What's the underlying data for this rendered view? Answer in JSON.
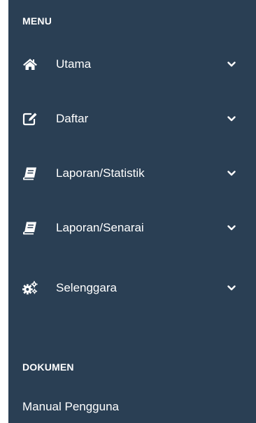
{
  "menu": {
    "title": "MENU",
    "items": [
      {
        "label": "Utama",
        "icon": "home-icon"
      },
      {
        "label": "Daftar",
        "icon": "edit-icon"
      },
      {
        "label": "Laporan/Statistik",
        "icon": "book-icon"
      },
      {
        "label": "Laporan/Senarai",
        "icon": "book-icon"
      },
      {
        "label": "Selenggara",
        "icon": "cogs-icon"
      }
    ]
  },
  "dokumen": {
    "title": "DOKUMEN",
    "link": "Manual Pengguna"
  },
  "colors": {
    "sidebar_bg": "#2a3f54",
    "text": "#ffffff"
  }
}
